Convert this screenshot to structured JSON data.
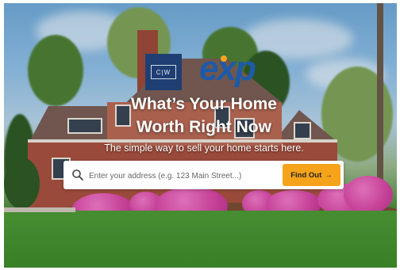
{
  "logo": {
    "monogram": "C|W",
    "brand": "exp",
    "accent_color": "#f5a623",
    "brand_color": "#1d5aa8"
  },
  "hero": {
    "headline_line1": "What’s Your Home",
    "headline_line2": "Worth Right Now",
    "subheadline": "The simple way to sell your home starts here."
  },
  "search": {
    "placeholder": "Enter your address (e.g. 123 Main Street...)",
    "value": "",
    "button_label": "Find Out",
    "button_arrow": "→",
    "button_color": "#f5a31b"
  }
}
